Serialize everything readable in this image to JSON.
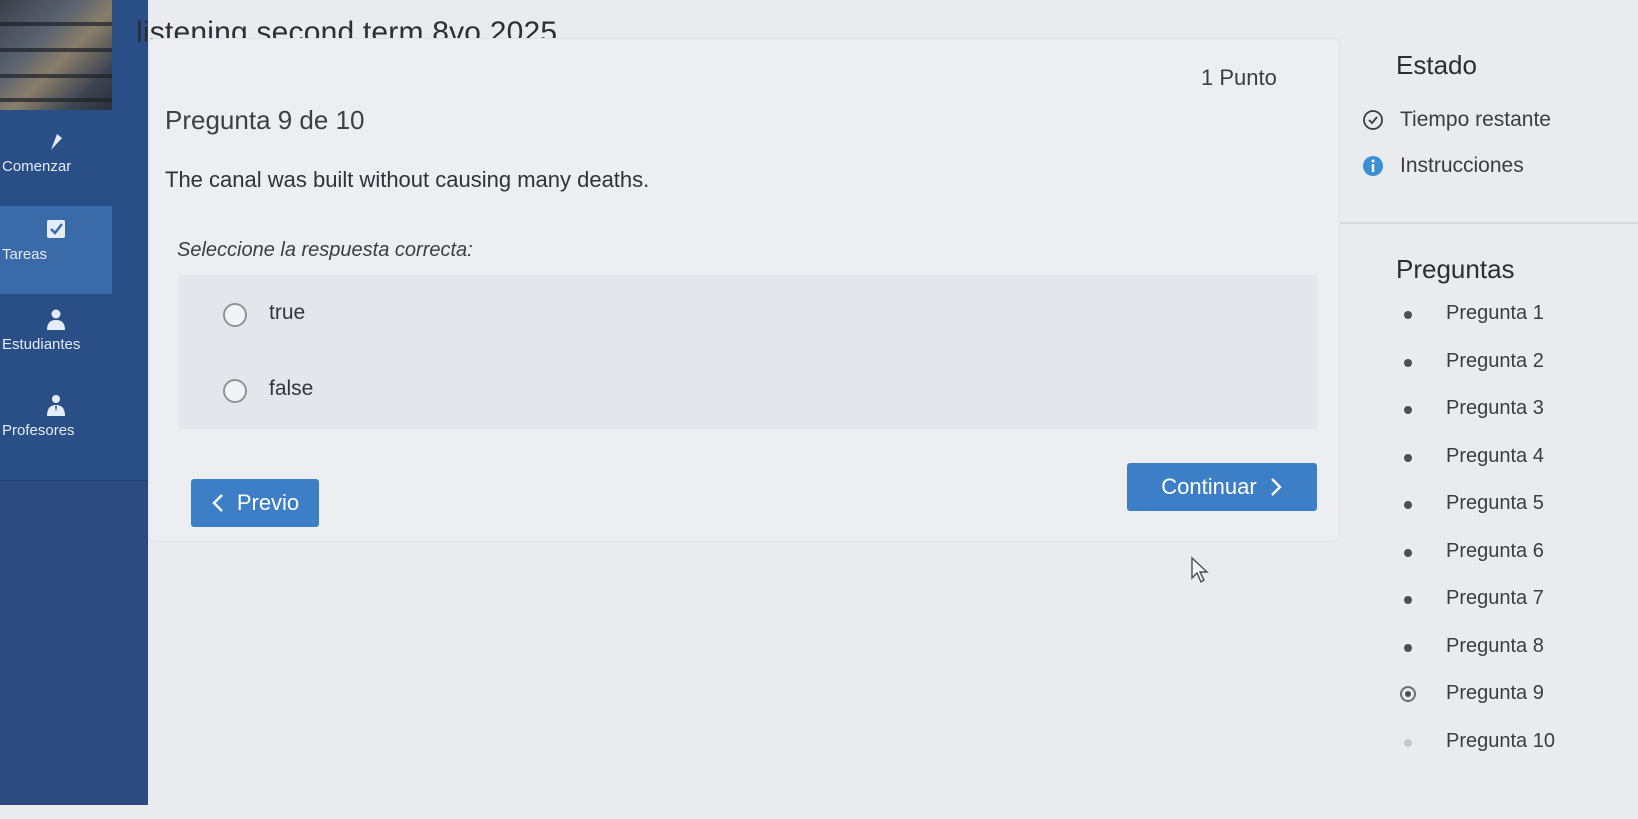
{
  "app": {
    "title": "listening second term 8vo 2025"
  },
  "sidebar": {
    "items": [
      {
        "label": "Comenzar",
        "icon": "flag-icon"
      },
      {
        "label": "Tareas",
        "icon": "checkbox-icon"
      },
      {
        "label": "Estudiantes",
        "icon": "user-icon"
      },
      {
        "label": "Profesores",
        "icon": "teacher-icon"
      }
    ],
    "active_index": 1
  },
  "question": {
    "points": "1 Punto",
    "counter": "Pregunta 9 de 10",
    "text": "The canal was built without causing many deaths.",
    "instruction": "Seleccione la respuesta correcta:",
    "options": [
      {
        "label": "true",
        "selected": false
      },
      {
        "label": "false",
        "selected": false
      }
    ]
  },
  "navigation": {
    "previous_label": "Previo",
    "continue_label": "Continuar"
  },
  "status": {
    "title": "Estado",
    "time_remaining_label": "Tiempo restante",
    "instructions_label": "Instrucciones"
  },
  "questions_panel": {
    "title": "Preguntas",
    "items": [
      "Pregunta 1",
      "Pregunta 2",
      "Pregunta 3",
      "Pregunta 4",
      "Pregunta 5",
      "Pregunta 6",
      "Pregunta 7",
      "Pregunta 8",
      "Pregunta 9",
      "Pregunta 10"
    ],
    "current_index": 8
  },
  "colors": {
    "sidebar": "#2a4e86",
    "sidebar_active": "#3a6aa8",
    "primary_button": "#3d7fc7",
    "info_icon": "#3b8fd6"
  }
}
